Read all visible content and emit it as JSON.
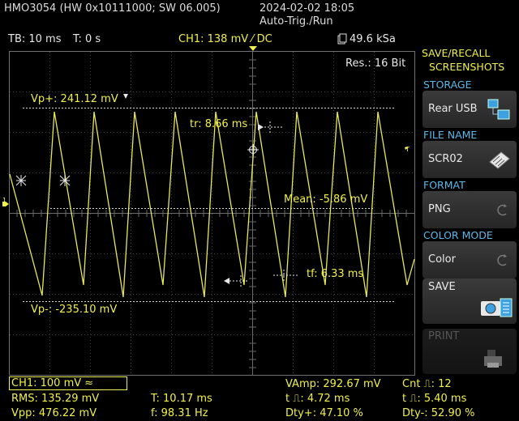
{
  "header": {
    "device": "HMO3054 (HW 0x10111000; SW 06.005)",
    "datetime": "2024-02-02 18:05",
    "trigger_mode": "Auto-Trig./Run"
  },
  "status_bar": {
    "timebase": "TB: 10 ms",
    "trigger_time": "T: 0 s",
    "channel": "CH1: 138 mV ⁄ DC",
    "sample_rate": "49.6 kSa"
  },
  "screen": {
    "resolution": "Res.: 16 Bit",
    "vp_plus": "Vp+: 241.12 mV",
    "vp_minus": "Vp-: -235.10 mV",
    "rise_time": "tr: 8.66 ms",
    "fall_time": "tf: 6.33 ms",
    "mean": "Mean: -5.86 mV"
  },
  "side_menu": {
    "title_line1": "SAVE/RECALL",
    "title_line2": "SCREENSHOTS",
    "storage_head": "STORAGE",
    "storage_value": "Rear USB",
    "filename_head": "FILE NAME",
    "filename_value": "SCR02",
    "format_head": "FORMAT",
    "format_value": "PNG",
    "colormode_head": "COLOR MODE",
    "colormode_value": "Color",
    "save_label": "SAVE",
    "print_label": "PRINT"
  },
  "measurements": {
    "ch1_scale": "CH1: 100 mV ≈",
    "rms": "RMS: 135.29 mV",
    "vpp": "Vpp: 476.22 mV",
    "period": "T: 10.17 ms",
    "frequency": "f: 98.31 Hz",
    "vamp": "VAmp: 292.67 mV",
    "neg_pulse": "t ⎍: 4.72 ms",
    "dty_plus": "Dty+: 47.10 %",
    "count": "Cnt ⎍: 12",
    "pos_pulse": "t ⎍: 5.40 ms",
    "dty_minus": "Dty-: 52.90 %"
  },
  "colors": {
    "trace": "#e8e852",
    "accent": "#5cb8e8",
    "grid": "#555555"
  }
}
